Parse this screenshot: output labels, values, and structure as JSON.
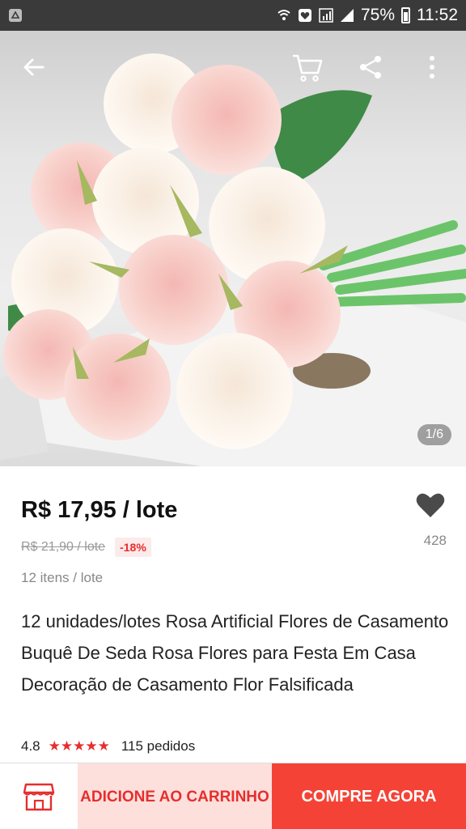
{
  "status_bar": {
    "battery": "75%",
    "time": "11:52"
  },
  "topbar": {
    "icons": [
      "back-arrow-icon",
      "cart-icon",
      "share-icon",
      "more-vert-icon"
    ]
  },
  "gallery": {
    "counter": "1/6"
  },
  "product": {
    "price": "R$ 17,95 / lote",
    "old_price": "R$ 21,90 / lote",
    "discount": "-18%",
    "lot_info": "12 itens / lote",
    "favorites_count": "428",
    "title": "12 unidades/lotes Rosa Artificial Flores de Casamento Buquê De Seda Rosa Flores para Festa Em Casa Decoração de Casamento Flor Falsificada",
    "rating": "4.8",
    "stars": "★★★★★",
    "orders": "115 pedidos"
  },
  "actions": {
    "add_to_cart": "ADICIONE AO CARRINHO",
    "buy_now": "COMPRE AGORA"
  },
  "colors": {
    "accent": "#e62e2e",
    "buy_button": "#f44336",
    "cart_button_bg": "#fde0dc"
  }
}
